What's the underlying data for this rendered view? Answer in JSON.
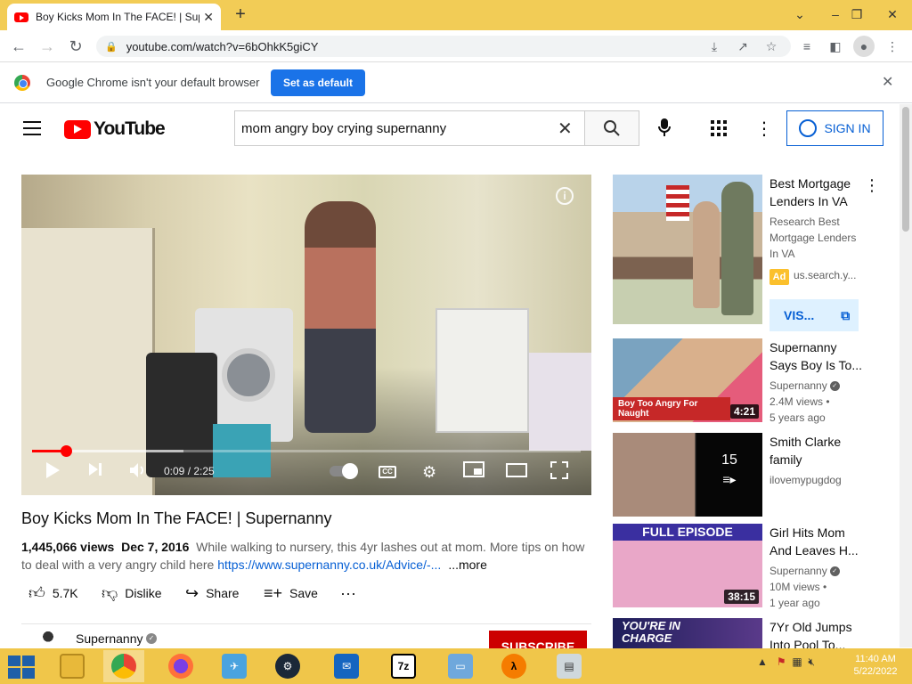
{
  "browser": {
    "tab_title": "Boy Kicks Mom In The FACE! | Supernanny",
    "url": "youtube.com/watch?v=6bOhkK5giCY",
    "infobar_text": "Google Chrome isn't your default browser",
    "set_default_label": "Set as default"
  },
  "youtube": {
    "logo_text": "YouTube",
    "search_query": "mom angry boy crying supernanny",
    "sign_in_label": "SIGN IN"
  },
  "player": {
    "time": "0:09 / 2:25",
    "progress_fraction": 0.062
  },
  "video": {
    "title": "Boy Kicks Mom In The FACE! | Supernanny",
    "views": "1,445,066 views",
    "date": "Dec 7, 2016",
    "description": "While walking to nursery, this 4yr lashes out at mom. More tips on how to deal with a very angry child here",
    "link": "https://www.supernanny.co.uk/Advice/-...",
    "more": "...more",
    "likes": "5.7K",
    "dislike": "Dislike",
    "share": "Share",
    "save": "Save",
    "channel": "Supernanny",
    "subscribe": "SUBSCRIBE"
  },
  "sidebar": {
    "ad": {
      "title": "Best Mortgage Lenders In VA",
      "desc": "Research Best Mortgage Lenders In VA",
      "badge": "Ad",
      "source": "us.search.y...",
      "visit": "VIS..."
    },
    "items": [
      {
        "title": "Supernanny Says Boy Is To...",
        "channel": "Supernanny",
        "views": "2.4M views •",
        "age": "5 years ago",
        "duration": "4:21",
        "caption": "Boy Too Angry For Naught"
      },
      {
        "title": "Smith Clarke family",
        "channel": "ilovemypugdog",
        "count": "15"
      },
      {
        "title": "Girl Hits Mom And Leaves H...",
        "channel": "Supernanny",
        "views": "10M views •",
        "age": "1 year ago",
        "duration": "38:15",
        "caption": "FULL EPISODE"
      },
      {
        "title": "7Yr Old Jumps Into Pool To...",
        "caption": "YOU'RE IN CHARGE"
      }
    ]
  },
  "taskbar": {
    "time": "11:40 AM",
    "date": "5/22/2022"
  }
}
